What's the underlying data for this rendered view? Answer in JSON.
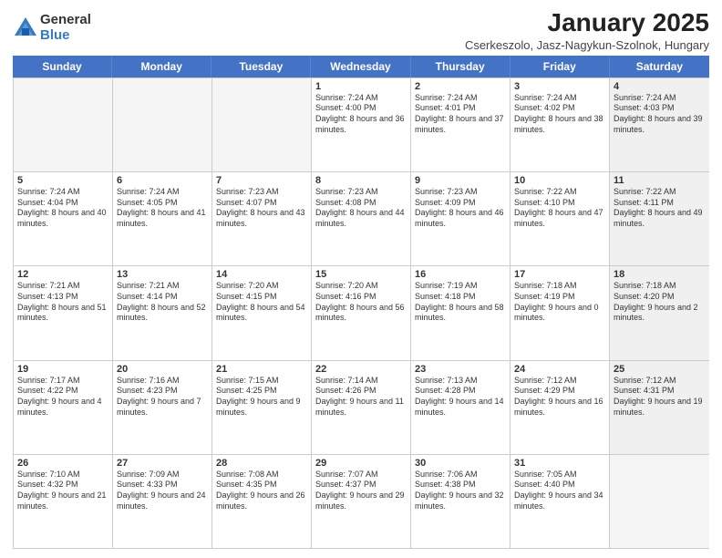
{
  "header": {
    "logo": {
      "general": "General",
      "blue": "Blue"
    },
    "title": "January 2025",
    "subtitle": "Cserkeszolo, Jasz-Nagykun-Szolnok, Hungary"
  },
  "days_of_week": [
    "Sunday",
    "Monday",
    "Tuesday",
    "Wednesday",
    "Thursday",
    "Friday",
    "Saturday"
  ],
  "rows": [
    [
      {
        "day": "",
        "text": "",
        "empty": true
      },
      {
        "day": "",
        "text": "",
        "empty": true
      },
      {
        "day": "",
        "text": "",
        "empty": true
      },
      {
        "day": "1",
        "text": "Sunrise: 7:24 AM\nSunset: 4:00 PM\nDaylight: 8 hours and 36 minutes."
      },
      {
        "day": "2",
        "text": "Sunrise: 7:24 AM\nSunset: 4:01 PM\nDaylight: 8 hours and 37 minutes."
      },
      {
        "day": "3",
        "text": "Sunrise: 7:24 AM\nSunset: 4:02 PM\nDaylight: 8 hours and 38 minutes."
      },
      {
        "day": "4",
        "text": "Sunrise: 7:24 AM\nSunset: 4:03 PM\nDaylight: 8 hours and 39 minutes.",
        "shaded": true
      }
    ],
    [
      {
        "day": "5",
        "text": "Sunrise: 7:24 AM\nSunset: 4:04 PM\nDaylight: 8 hours and 40 minutes."
      },
      {
        "day": "6",
        "text": "Sunrise: 7:24 AM\nSunset: 4:05 PM\nDaylight: 8 hours and 41 minutes."
      },
      {
        "day": "7",
        "text": "Sunrise: 7:23 AM\nSunset: 4:07 PM\nDaylight: 8 hours and 43 minutes."
      },
      {
        "day": "8",
        "text": "Sunrise: 7:23 AM\nSunset: 4:08 PM\nDaylight: 8 hours and 44 minutes."
      },
      {
        "day": "9",
        "text": "Sunrise: 7:23 AM\nSunset: 4:09 PM\nDaylight: 8 hours and 46 minutes."
      },
      {
        "day": "10",
        "text": "Sunrise: 7:22 AM\nSunset: 4:10 PM\nDaylight: 8 hours and 47 minutes."
      },
      {
        "day": "11",
        "text": "Sunrise: 7:22 AM\nSunset: 4:11 PM\nDaylight: 8 hours and 49 minutes.",
        "shaded": true
      }
    ],
    [
      {
        "day": "12",
        "text": "Sunrise: 7:21 AM\nSunset: 4:13 PM\nDaylight: 8 hours and 51 minutes."
      },
      {
        "day": "13",
        "text": "Sunrise: 7:21 AM\nSunset: 4:14 PM\nDaylight: 8 hours and 52 minutes."
      },
      {
        "day": "14",
        "text": "Sunrise: 7:20 AM\nSunset: 4:15 PM\nDaylight: 8 hours and 54 minutes."
      },
      {
        "day": "15",
        "text": "Sunrise: 7:20 AM\nSunset: 4:16 PM\nDaylight: 8 hours and 56 minutes."
      },
      {
        "day": "16",
        "text": "Sunrise: 7:19 AM\nSunset: 4:18 PM\nDaylight: 8 hours and 58 minutes."
      },
      {
        "day": "17",
        "text": "Sunrise: 7:18 AM\nSunset: 4:19 PM\nDaylight: 9 hours and 0 minutes."
      },
      {
        "day": "18",
        "text": "Sunrise: 7:18 AM\nSunset: 4:20 PM\nDaylight: 9 hours and 2 minutes.",
        "shaded": true
      }
    ],
    [
      {
        "day": "19",
        "text": "Sunrise: 7:17 AM\nSunset: 4:22 PM\nDaylight: 9 hours and 4 minutes."
      },
      {
        "day": "20",
        "text": "Sunrise: 7:16 AM\nSunset: 4:23 PM\nDaylight: 9 hours and 7 minutes."
      },
      {
        "day": "21",
        "text": "Sunrise: 7:15 AM\nSunset: 4:25 PM\nDaylight: 9 hours and 9 minutes."
      },
      {
        "day": "22",
        "text": "Sunrise: 7:14 AM\nSunset: 4:26 PM\nDaylight: 9 hours and 11 minutes."
      },
      {
        "day": "23",
        "text": "Sunrise: 7:13 AM\nSunset: 4:28 PM\nDaylight: 9 hours and 14 minutes."
      },
      {
        "day": "24",
        "text": "Sunrise: 7:12 AM\nSunset: 4:29 PM\nDaylight: 9 hours and 16 minutes."
      },
      {
        "day": "25",
        "text": "Sunrise: 7:12 AM\nSunset: 4:31 PM\nDaylight: 9 hours and 19 minutes.",
        "shaded": true
      }
    ],
    [
      {
        "day": "26",
        "text": "Sunrise: 7:10 AM\nSunset: 4:32 PM\nDaylight: 9 hours and 21 minutes."
      },
      {
        "day": "27",
        "text": "Sunrise: 7:09 AM\nSunset: 4:33 PM\nDaylight: 9 hours and 24 minutes."
      },
      {
        "day": "28",
        "text": "Sunrise: 7:08 AM\nSunset: 4:35 PM\nDaylight: 9 hours and 26 minutes."
      },
      {
        "day": "29",
        "text": "Sunrise: 7:07 AM\nSunset: 4:37 PM\nDaylight: 9 hours and 29 minutes."
      },
      {
        "day": "30",
        "text": "Sunrise: 7:06 AM\nSunset: 4:38 PM\nDaylight: 9 hours and 32 minutes."
      },
      {
        "day": "31",
        "text": "Sunrise: 7:05 AM\nSunset: 4:40 PM\nDaylight: 9 hours and 34 minutes."
      },
      {
        "day": "",
        "text": "",
        "empty": true,
        "shaded": true
      }
    ]
  ]
}
